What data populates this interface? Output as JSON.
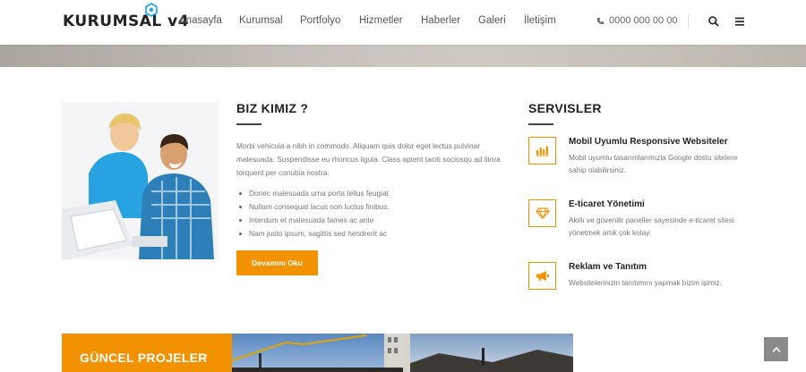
{
  "header": {
    "logo": "KURUMSAL v4",
    "nav": [
      "Anasayfa",
      "Kurumsal",
      "Portfolyo",
      "Hizmetler",
      "Haberler",
      "Galeri",
      "İletişim"
    ],
    "phone": "0000 000 00 00"
  },
  "about": {
    "title": "BIZ KIMIZ ?",
    "text": "Morbi vehicula a nibh in commodo. Aliquam quis dolor eget lectus pulvinar malesuada. Suspendisse eu rhoncus ligula. Class aptent taciti sociosqu ad litora torquent per conubia nostra.",
    "list": [
      "Donec malesuada urna porta tellus feugiat",
      "Nullam consequat lacus non luctus finibus.",
      "Interdum et malesuada fames ac ante",
      "Nam justo ipsum, sagittis sed hendrerit ac"
    ],
    "button": "Devamını Oku"
  },
  "services": {
    "title": "SERVISLER",
    "items": [
      {
        "title": "Mobil Uyumlu Responsive Websiteler",
        "desc": "Mobil uyumlu tasarımlarımızla Google dostu sitelere sahip olabilirsiniz.",
        "icon": "bar-chart-icon"
      },
      {
        "title": "E-ticaret Yönetimi",
        "desc": "Akıllı ve güvenilir paneller sayesinde e-ticaret sitesi yönetmek artık çok kolay.",
        "icon": "diamond-icon"
      },
      {
        "title": "Reklam ve Tanıtım",
        "desc": "Websitelerinizin tanıtımını yapmak bizim işimiz.",
        "icon": "megaphone-icon"
      }
    ]
  },
  "projects": {
    "title": "GÜNCEL PROJELER"
  },
  "colors": {
    "accent": "#f39200",
    "text": "#222222",
    "muted": "#777777"
  }
}
